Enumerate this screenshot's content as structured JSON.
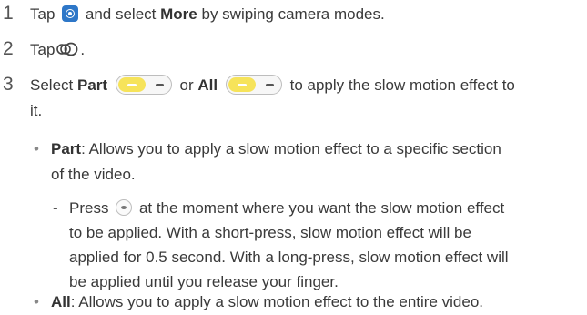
{
  "steps": [
    {
      "number": "1",
      "parts": {
        "a": "Tap",
        "b": "and select",
        "c": "More",
        "d": "by swiping camera modes."
      }
    },
    {
      "number": "2",
      "parts": {
        "a": "Tap",
        "b": "."
      }
    },
    {
      "number": "3",
      "parts": {
        "a": "Select",
        "b": "Part",
        "c": "or",
        "d": "All",
        "e": "to apply the slow motion effect to",
        "f": "it."
      }
    }
  ],
  "bullets": [
    {
      "marker": "•",
      "term": "Part",
      "line1": ": Allows you to apply a slow motion effect to a specific section",
      "line2": "of the video."
    },
    {
      "marker": "•",
      "term": "All",
      "line1": ": Allows you to apply a slow motion effect to the entire video."
    }
  ],
  "sub_item": {
    "marker": "-",
    "line1a": "Press",
    "line1b": "at the moment where you want the slow motion effect",
    "line2": "to be applied. With a short-press, slow motion effect will be",
    "line3": "applied for 0.5 second. With a long-press, slow motion effect will",
    "line4": "be applied until you release your finger."
  },
  "icons": {
    "camera": "camera-app-icon",
    "slowmo": "slow-motion-icon",
    "toggle_part": "toggle-part-icon",
    "toggle_all": "toggle-all-icon",
    "capture": "capture-button-icon"
  },
  "colors": {
    "text": "#3a3a3a",
    "camera_icon": "#2e77c8",
    "toggle_on": "#f6e35a"
  }
}
